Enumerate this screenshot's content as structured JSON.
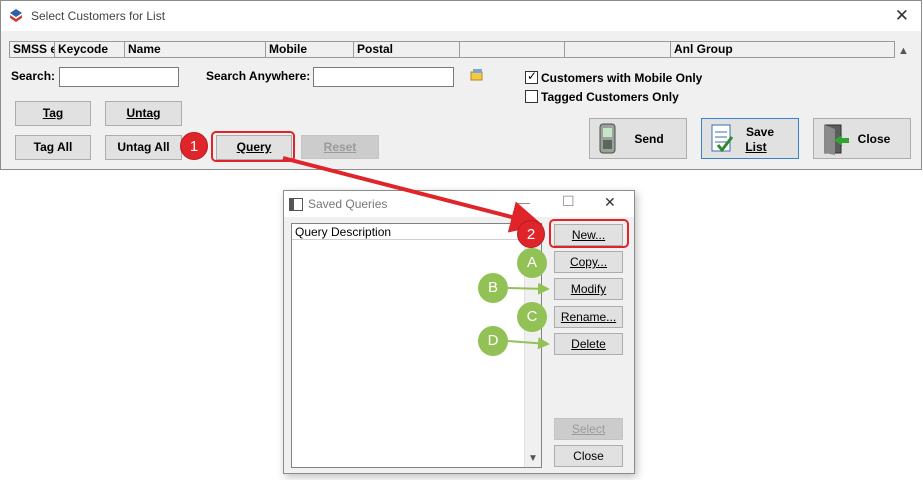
{
  "main_window": {
    "title": "Select Customers for List",
    "close_glyph": "✕",
    "columns": [
      "SMSS e",
      "Keycode",
      "Name",
      "Mobile",
      "Postal",
      "",
      "",
      "Anl Group"
    ],
    "search_label": "Search:",
    "search_value": "",
    "search_anywhere_label": "Search Anywhere:",
    "search_anywhere_value": "",
    "mobile_only_label": "Customers with Mobile Only",
    "mobile_only_checked": true,
    "tagged_only_label": "Tagged Customers Only",
    "tagged_only_checked": false,
    "buttons": {
      "tag": "Tag",
      "untag": "Untag",
      "tag_all": "Tag All",
      "untag_all": "Untag All",
      "query": "Query",
      "reset": "Reset",
      "send": "Send",
      "save_list_line1": "Save",
      "save_list_line2": "List",
      "close": "Close"
    }
  },
  "saved_queries": {
    "title": "Saved Queries",
    "list_header": "Query Description",
    "items": [],
    "buttons": {
      "new": "New...",
      "copy": "Copy...",
      "modify": "Modify",
      "rename": "Rename...",
      "delete": "Delete",
      "select": "Select",
      "close": "Close"
    }
  },
  "annotations": {
    "step1": "1",
    "step2": "2",
    "a": "A",
    "b": "B",
    "c": "C",
    "d": "D",
    "red_color": "#e0252a",
    "green_color": "#92c155"
  }
}
